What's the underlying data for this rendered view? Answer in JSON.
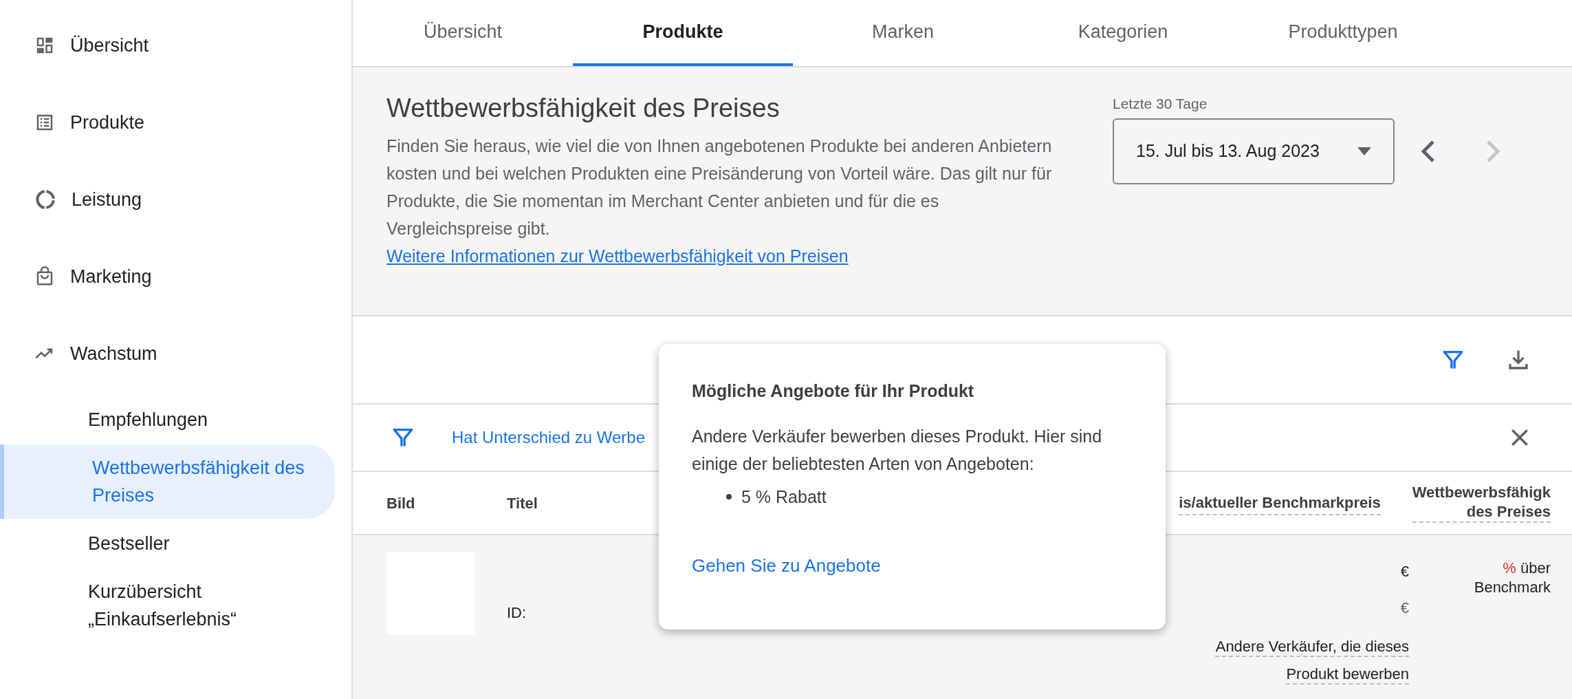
{
  "sidebar": {
    "items": [
      {
        "label": "Übersicht",
        "selected": false
      },
      {
        "label": "Produkte",
        "selected": false
      },
      {
        "label": "Leistung",
        "selected": false
      },
      {
        "label": "Marketing",
        "selected": false
      },
      {
        "label": "Wachstum",
        "selected": false,
        "children": [
          {
            "label": "Empfehlungen",
            "selected": false
          },
          {
            "label": "Wettbewerbsfähigkeit des Preises",
            "selected": true
          },
          {
            "label": "Bestseller",
            "selected": false
          },
          {
            "label": "Kurzübersicht „Einkaufserlebnis“",
            "selected": false
          }
        ]
      }
    ]
  },
  "tabs": [
    {
      "label": "Übersicht",
      "selected": false
    },
    {
      "label": "Produkte",
      "selected": true
    },
    {
      "label": "Marken",
      "selected": false
    },
    {
      "label": "Kategorien",
      "selected": false
    },
    {
      "label": "Produkttypen",
      "selected": false
    }
  ],
  "header": {
    "title": "Wettbewerbsfähigkeit des Preises",
    "description": "Finden Sie heraus, wie viel die von Ihnen angebotenen Produkte bei anderen Anbietern kosten und bei welchen Produkten eine Preisänderung von Vorteil wäre. Das gilt nur für Produkte, die Sie momentan im Merchant Center anbieten und für die es Vergleichspreise gibt.",
    "link": "Weitere Informationen zur Wettbewerbsfähigkeit von Preisen",
    "date_range": {
      "label": "Letzte 30 Tage",
      "value": "15. Jul bis 13. Aug 2023",
      "prev_disabled": false,
      "next_disabled": true
    }
  },
  "toolbar": {
    "filter_active": true
  },
  "filter": {
    "text": "Hat Unterschied zu Werbe"
  },
  "table": {
    "columns": [
      "Bild",
      "Titel",
      "is/aktueller Benchmarkpreis",
      "Wettbewerbsfähigk\ndes Preises"
    ],
    "rows": [
      {
        "id_label": "ID:",
        "price": "€",
        "benchmark": "€",
        "offers_link": "Andere Verkäufer, die dieses Produkt bewerben",
        "percent": "%",
        "competitiveness": "über Benchmark"
      }
    ]
  },
  "popover": {
    "title": "Mögliche Angebote für Ihr Produkt",
    "text": "Andere Verkäufer bewerben dieses Produkt. Hier sind einige der beliebtesten Arten von Angeboten:",
    "bullets": [
      "5 % Rabatt"
    ],
    "link": "Gehen Sie zu Angebote"
  }
}
